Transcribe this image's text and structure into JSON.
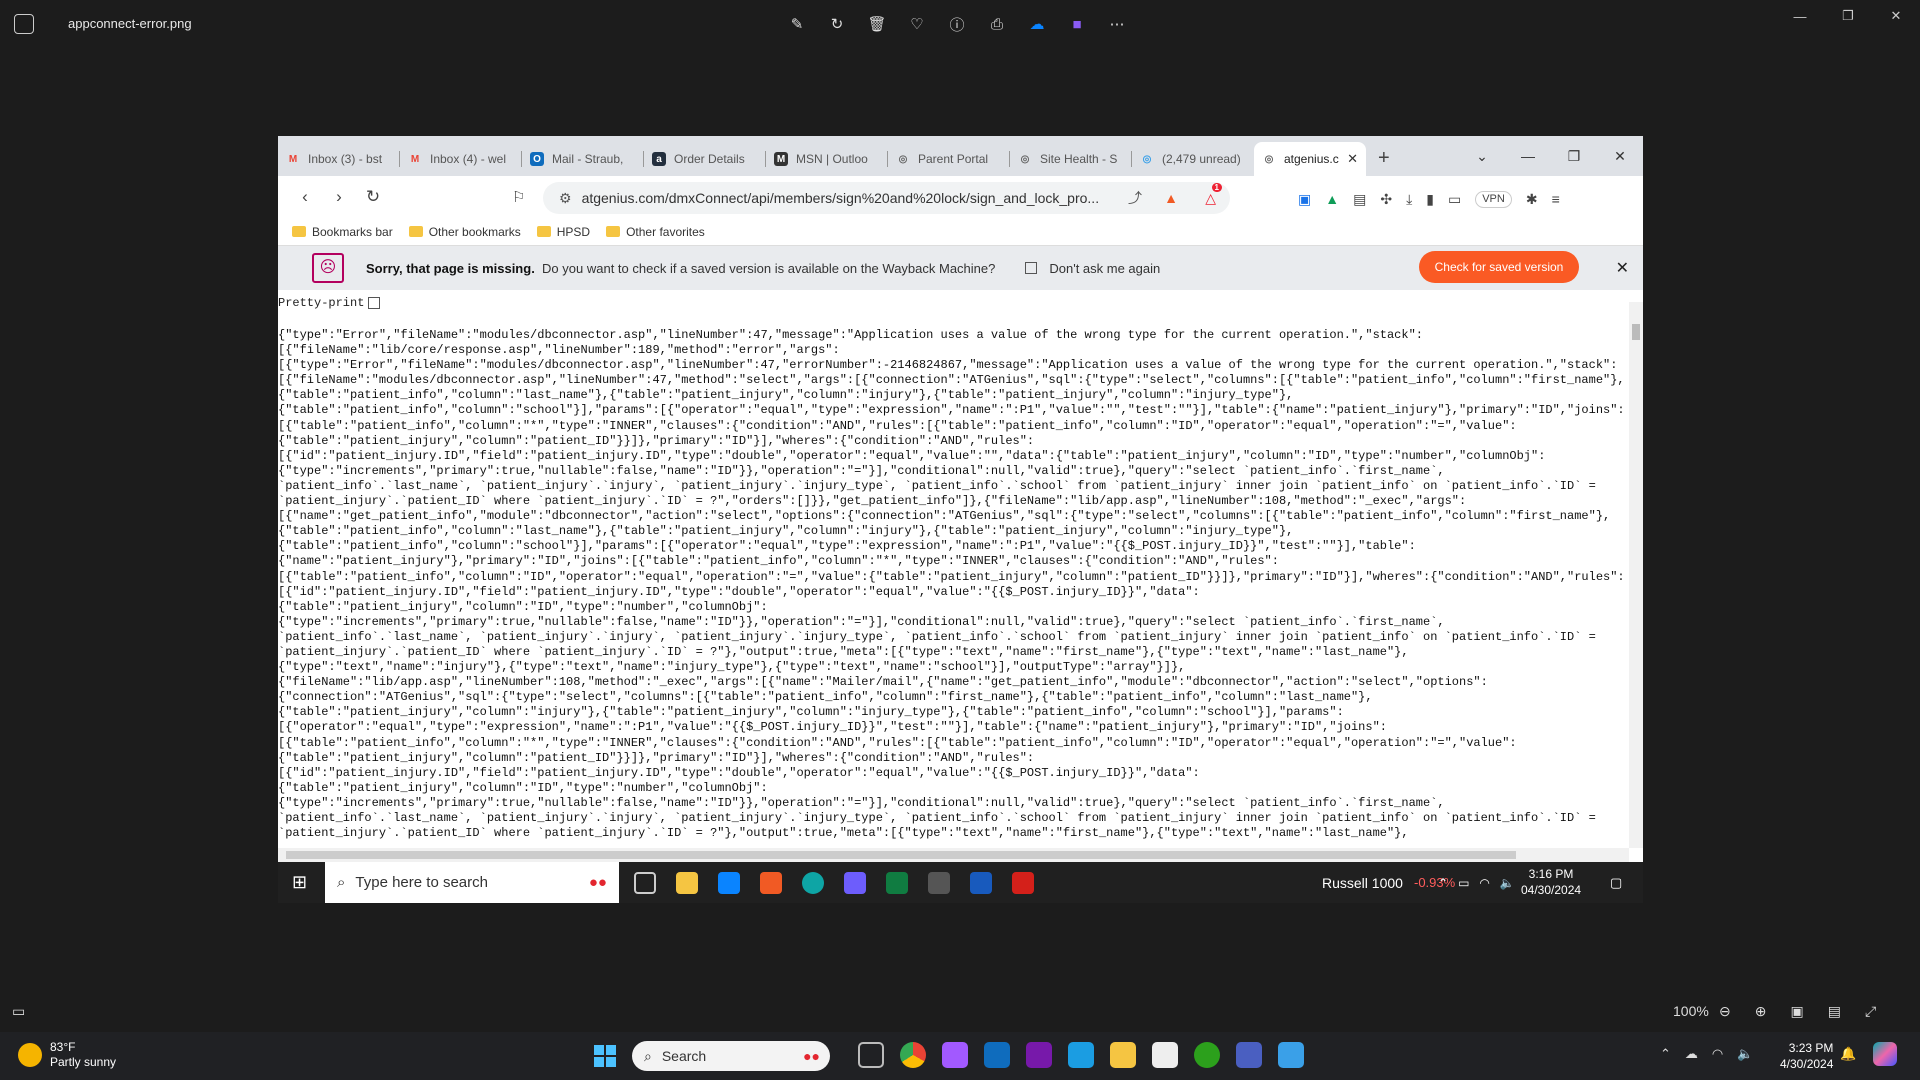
{
  "viewer": {
    "file_name": "appconnect-error.png",
    "zoom": "100%",
    "toolbar_icons": [
      "edit-icon",
      "rotate-icon",
      "delete-icon",
      "favorite-icon",
      "info-icon",
      "print-icon",
      "onedrive-icon",
      "clipchamp-icon",
      "more-icon"
    ]
  },
  "browser": {
    "tabs": [
      {
        "label": "Inbox (3) - bst",
        "fav": "M",
        "color": "#ea4335"
      },
      {
        "label": "Inbox (4) - wel",
        "fav": "M",
        "color": "#ea4335"
      },
      {
        "label": "Mail - Straub,",
        "fav": "O",
        "color": "#0f6cbd"
      },
      {
        "label": "Order Details",
        "fav": "a",
        "color": "#232f3e"
      },
      {
        "label": "MSN | Outloo",
        "fav": "M",
        "color": "#333333"
      },
      {
        "label": "Parent Portal",
        "fav": "◎",
        "color": "#666666"
      },
      {
        "label": "Site Health - S",
        "fav": "◎",
        "color": "#666666"
      },
      {
        "label": "(2,479 unread)",
        "fav": "◎",
        "color": "#3aa0e8"
      }
    ],
    "active_tab": "atgenius.c",
    "url": "atgenius.com/dmxConnect/api/members/sign%20and%20lock/sign_and_lock_pro...",
    "brave_badge": "1",
    "vpn_label": "VPN",
    "bookmarks": [
      "Bookmarks bar",
      "Other bookmarks",
      "HPSD",
      "Other favorites"
    ],
    "infobar": {
      "title": "Sorry, that page is missing.",
      "question": "Do you want to check if a saved version is available on the Wayback Machine?",
      "dont_ask": "Don't ask me again",
      "cta": "Check for saved version"
    },
    "pretty_print": "Pretty-print",
    "json_text": "{\"type\":\"Error\",\"fileName\":\"modules/dbconnector.asp\",\"lineNumber\":47,\"message\":\"Application uses a value of the wrong type for the current operation.\",\"stack\":\n[{\"fileName\":\"lib/core/response.asp\",\"lineNumber\":189,\"method\":\"error\",\"args\":\n[{\"type\":\"Error\",\"fileName\":\"modules/dbconnector.asp\",\"lineNumber\":47,\"errorNumber\":-2146824867,\"message\":\"Application uses a value of the wrong type for the current operation.\",\"stack\":\n[{\"fileName\":\"modules/dbconnector.asp\",\"lineNumber\":47,\"method\":\"select\",\"args\":[{\"connection\":\"ATGenius\",\"sql\":{\"type\":\"select\",\"columns\":[{\"table\":\"patient_info\",\"column\":\"first_name\"},\n{\"table\":\"patient_info\",\"column\":\"last_name\"},{\"table\":\"patient_injury\",\"column\":\"injury\"},{\"table\":\"patient_injury\",\"column\":\"injury_type\"},\n{\"table\":\"patient_info\",\"column\":\"school\"}],\"params\":[{\"operator\":\"equal\",\"type\":\"expression\",\"name\":\":P1\",\"value\":\"\",\"test\":\"\"}],\"table\":{\"name\":\"patient_injury\"},\"primary\":\"ID\",\"joins\":\n[{\"table\":\"patient_info\",\"column\":\"*\",\"type\":\"INNER\",\"clauses\":{\"condition\":\"AND\",\"rules\":[{\"table\":\"patient_info\",\"column\":\"ID\",\"operator\":\"equal\",\"operation\":\"=\",\"value\":\n{\"table\":\"patient_injury\",\"column\":\"patient_ID\"}}]},\"primary\":\"ID\"}],\"wheres\":{\"condition\":\"AND\",\"rules\":\n[{\"id\":\"patient_injury.ID\",\"field\":\"patient_injury.ID\",\"type\":\"double\",\"operator\":\"equal\",\"value\":\"\",\"data\":{\"table\":\"patient_injury\",\"column\":\"ID\",\"type\":\"number\",\"columnObj\":\n{\"type\":\"increments\",\"primary\":true,\"nullable\":false,\"name\":\"ID\"}},\"operation\":\"=\"}],\"conditional\":null,\"valid\":true},\"query\":\"select `patient_info`.`first_name`,\n`patient_info`.`last_name`, `patient_injury`.`injury`, `patient_injury`.`injury_type`, `patient_info`.`school` from `patient_injury` inner join `patient_info` on `patient_info`.`ID` =\n`patient_injury`.`patient_ID` where `patient_injury`.`ID` = ?\",\"orders\":[]}},\"get_patient_info\"]},{\"fileName\":\"lib/app.asp\",\"lineNumber\":108,\"method\":\"_exec\",\"args\":\n[{\"name\":\"get_patient_info\",\"module\":\"dbconnector\",\"action\":\"select\",\"options\":{\"connection\":\"ATGenius\",\"sql\":{\"type\":\"select\",\"columns\":[{\"table\":\"patient_info\",\"column\":\"first_name\"},\n{\"table\":\"patient_info\",\"column\":\"last_name\"},{\"table\":\"patient_injury\",\"column\":\"injury\"},{\"table\":\"patient_injury\",\"column\":\"injury_type\"},\n{\"table\":\"patient_info\",\"column\":\"school\"}],\"params\":[{\"operator\":\"equal\",\"type\":\"expression\",\"name\":\":P1\",\"value\":\"{{$_POST.injury_ID}}\",\"test\":\"\"}],\"table\":\n{\"name\":\"patient_injury\"},\"primary\":\"ID\",\"joins\":[{\"table\":\"patient_info\",\"column\":\"*\",\"type\":\"INNER\",\"clauses\":{\"condition\":\"AND\",\"rules\":\n[{\"table\":\"patient_info\",\"column\":\"ID\",\"operator\":\"equal\",\"operation\":\"=\",\"value\":{\"table\":\"patient_injury\",\"column\":\"patient_ID\"}}]},\"primary\":\"ID\"}],\"wheres\":{\"condition\":\"AND\",\"rules\":\n[{\"id\":\"patient_injury.ID\",\"field\":\"patient_injury.ID\",\"type\":\"double\",\"operator\":\"equal\",\"value\":\"{{$_POST.injury_ID}}\",\"data\":\n{\"table\":\"patient_injury\",\"column\":\"ID\",\"type\":\"number\",\"columnObj\":\n{\"type\":\"increments\",\"primary\":true,\"nullable\":false,\"name\":\"ID\"}},\"operation\":\"=\"}],\"conditional\":null,\"valid\":true},\"query\":\"select `patient_info`.`first_name`,\n`patient_info`.`last_name`, `patient_injury`.`injury`, `patient_injury`.`injury_type`, `patient_info`.`school` from `patient_injury` inner join `patient_info` on `patient_info`.`ID` =\n`patient_injury`.`patient_ID` where `patient_injury`.`ID` = ?\"},\"output\":true,\"meta\":[{\"type\":\"text\",\"name\":\"first_name\"},{\"type\":\"text\",\"name\":\"last_name\"},\n{\"type\":\"text\",\"name\":\"injury\"},{\"type\":\"text\",\"name\":\"injury_type\"},{\"type\":\"text\",\"name\":\"school\"}],\"outputType\":\"array\"}]},\n{\"fileName\":\"lib/app.asp\",\"lineNumber\":108,\"method\":\"_exec\",\"args\":[{\"name\":\"Mailer/mail\",{\"name\":\"get_patient_info\",\"module\":\"dbconnector\",\"action\":\"select\",\"options\":\n{\"connection\":\"ATGenius\",\"sql\":{\"type\":\"select\",\"columns\":[{\"table\":\"patient_info\",\"column\":\"first_name\"},{\"table\":\"patient_info\",\"column\":\"last_name\"},\n{\"table\":\"patient_injury\",\"column\":\"injury\"},{\"table\":\"patient_injury\",\"column\":\"injury_type\"},{\"table\":\"patient_info\",\"column\":\"school\"}],\"params\":\n[{\"operator\":\"equal\",\"type\":\"expression\",\"name\":\":P1\",\"value\":\"{{$_POST.injury_ID}}\",\"test\":\"\"}],\"table\":{\"name\":\"patient_injury\"},\"primary\":\"ID\",\"joins\":\n[{\"table\":\"patient_info\",\"column\":\"*\",\"type\":\"INNER\",\"clauses\":{\"condition\":\"AND\",\"rules\":[{\"table\":\"patient_info\",\"column\":\"ID\",\"operator\":\"equal\",\"operation\":\"=\",\"value\":\n{\"table\":\"patient_injury\",\"column\":\"patient_ID\"}}]},\"primary\":\"ID\"}],\"wheres\":{\"condition\":\"AND\",\"rules\":\n[{\"id\":\"patient_injury.ID\",\"field\":\"patient_injury.ID\",\"type\":\"double\",\"operator\":\"equal\",\"value\":\"{{$_POST.injury_ID}}\",\"data\":\n{\"table\":\"patient_injury\",\"column\":\"ID\",\"type\":\"number\",\"columnObj\":\n{\"type\":\"increments\",\"primary\":true,\"nullable\":false,\"name\":\"ID\"}},\"operation\":\"=\"}],\"conditional\":null,\"valid\":true},\"query\":\"select `patient_info`.`first_name`,\n`patient_info`.`last_name`, `patient_injury`.`injury`, `patient_injury`.`injury_type`, `patient_info`.`school` from `patient_injury` inner join `patient_info` on `patient_info`.`ID` =\n`patient_injury`.`patient_ID` where `patient_injury`.`ID` = ?\"},\"output\":true,\"meta\":[{\"type\":\"text\",\"name\":\"first_name\"},{\"type\":\"text\",\"name\":\"last_name\"},"
  },
  "inner_taskbar": {
    "search_placeholder": "Type here to search",
    "ticker_name": "Russell 1000",
    "ticker_change": "-0.93%",
    "time": "3:16 PM",
    "date": "04/30/2024"
  },
  "taskbar": {
    "weather_temp": "83°F",
    "weather_desc": "Partly sunny",
    "search_label": "Search",
    "time": "3:23 PM",
    "date": "4/30/2024"
  },
  "colors": {
    "accent_orange": "#fa5a24",
    "error_red": "#ff5c5c"
  }
}
